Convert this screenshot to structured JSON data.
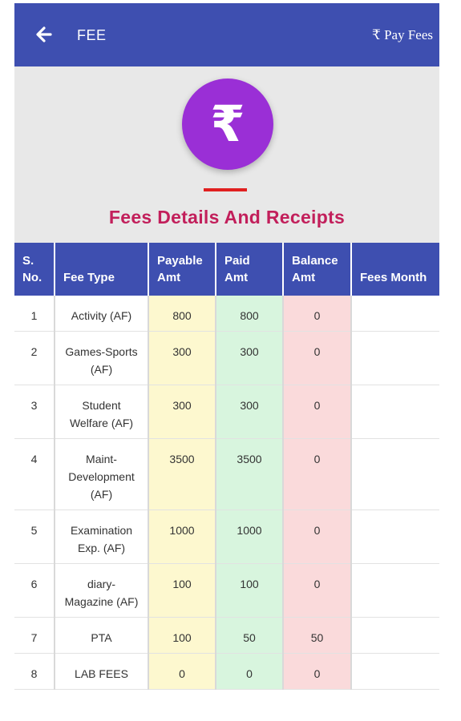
{
  "header": {
    "title": "FEE",
    "pay_label": "₹ Pay Fees"
  },
  "hero": {
    "icon_symbol": "₹",
    "title": "Fees Details And Receipts"
  },
  "colors": {
    "primary": "#3e4fb0",
    "icon_bg": "#9a2fd6",
    "title_color": "#c21f5b",
    "payable_bg": "#fdf8cf",
    "paid_bg": "#d8f5de",
    "balance_bg": "#fadadb"
  },
  "table": {
    "columns": [
      "S. No.",
      "Fee Type",
      "Payable Amt",
      "Paid Amt",
      "Balance Amt",
      "Fees Month"
    ],
    "rows": [
      {
        "sno": "1",
        "fee_type": "Activity (AF)",
        "payable": "800",
        "paid": "800",
        "balance": "0",
        "month": ""
      },
      {
        "sno": "2",
        "fee_type": "Games-Sports (AF)",
        "payable": "300",
        "paid": "300",
        "balance": "0",
        "month": ""
      },
      {
        "sno": "3",
        "fee_type": "Student Welfare (AF)",
        "payable": "300",
        "paid": "300",
        "balance": "0",
        "month": ""
      },
      {
        "sno": "4",
        "fee_type": "Maint-Development (AF)",
        "payable": "3500",
        "paid": "3500",
        "balance": "0",
        "month": ""
      },
      {
        "sno": "5",
        "fee_type": "Examination Exp. (AF)",
        "payable": "1000",
        "paid": "1000",
        "balance": "0",
        "month": ""
      },
      {
        "sno": "6",
        "fee_type": "diary-Magazine (AF)",
        "payable": "100",
        "paid": "100",
        "balance": "0",
        "month": ""
      },
      {
        "sno": "7",
        "fee_type": "PTA",
        "payable": "100",
        "paid": "50",
        "balance": "50",
        "month": ""
      },
      {
        "sno": "8",
        "fee_type": "LAB FEES",
        "payable": "0",
        "paid": "0",
        "balance": "0",
        "month": ""
      }
    ]
  }
}
